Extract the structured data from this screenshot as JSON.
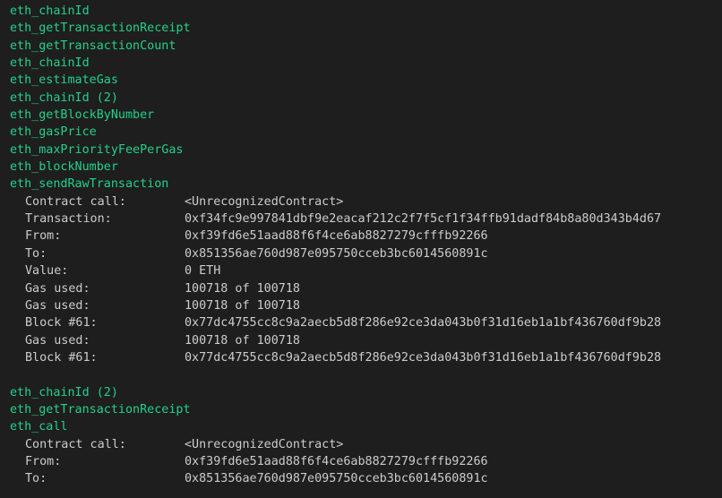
{
  "log": [
    {
      "kind": "method",
      "text": "eth_chainId"
    },
    {
      "kind": "method",
      "text": "eth_getTransactionReceipt"
    },
    {
      "kind": "method",
      "text": "eth_getTransactionCount"
    },
    {
      "kind": "method",
      "text": "eth_chainId"
    },
    {
      "kind": "method",
      "text": "eth_estimateGas"
    },
    {
      "kind": "method",
      "text": "eth_chainId (2)"
    },
    {
      "kind": "method",
      "text": "eth_getBlockByNumber"
    },
    {
      "kind": "method",
      "text": "eth_gasPrice"
    },
    {
      "kind": "method",
      "text": "eth_maxPriorityFeePerGas"
    },
    {
      "kind": "method",
      "text": "eth_blockNumber"
    },
    {
      "kind": "method",
      "text": "eth_sendRawTransaction"
    },
    {
      "kind": "detail",
      "key": "Contract call:",
      "value": "<UnrecognizedContract>"
    },
    {
      "kind": "detail",
      "key": "Transaction:",
      "value": "0xf34fc9e997841dbf9e2eacaf212c2f7f5cf1f34ffb91dadf84b8a80d343b4d67"
    },
    {
      "kind": "detail",
      "key": "From:",
      "value": "0xf39fd6e51aad88f6f4ce6ab8827279cfffb92266"
    },
    {
      "kind": "detail",
      "key": "To:",
      "value": "0x851356ae760d987e095750cceb3bc6014560891c"
    },
    {
      "kind": "detail",
      "key": "Value:",
      "value": "0 ETH"
    },
    {
      "kind": "detail",
      "key": "Gas used:",
      "value": "100718 of 100718"
    },
    {
      "kind": "detail",
      "key": "Gas used:",
      "value": "100718 of 100718"
    },
    {
      "kind": "detail",
      "key": "Block #61:",
      "value": "0x77dc4755cc8c9a2aecb5d8f286e92ce3da043b0f31d16eb1a1bf436760df9b28"
    },
    {
      "kind": "detail",
      "key": "Gas used:",
      "value": "100718 of 100718"
    },
    {
      "kind": "detail",
      "key": "Block #61:",
      "value": "0x77dc4755cc8c9a2aecb5d8f286e92ce3da043b0f31d16eb1a1bf436760df9b28"
    },
    {
      "kind": "blank"
    },
    {
      "kind": "method",
      "text": "eth_chainId (2)"
    },
    {
      "kind": "method",
      "text": "eth_getTransactionReceipt"
    },
    {
      "kind": "method",
      "text": "eth_call"
    },
    {
      "kind": "detail",
      "key": "Contract call:",
      "value": "<UnrecognizedContract>"
    },
    {
      "kind": "detail",
      "key": "From:",
      "value": "0xf39fd6e51aad88f6f4ce6ab8827279cfffb92266"
    },
    {
      "kind": "detail",
      "key": "To:",
      "value": "0x851356ae760d987e095750cceb3bc6014560891c"
    }
  ]
}
